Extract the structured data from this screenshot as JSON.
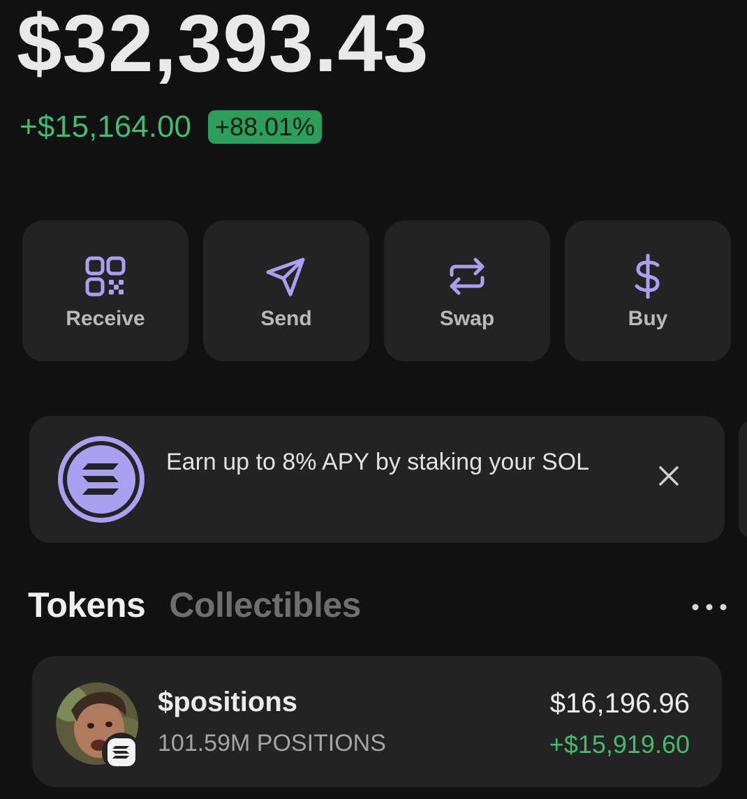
{
  "portfolio": {
    "balance": "$32,393.43",
    "change_amount": "+$15,164.00",
    "change_percent": "+88.01%"
  },
  "actions": [
    {
      "label": "Receive",
      "icon": "qr-code-icon"
    },
    {
      "label": "Send",
      "icon": "send-icon"
    },
    {
      "label": "Swap",
      "icon": "swap-icon"
    },
    {
      "label": "Buy",
      "icon": "dollar-icon"
    }
  ],
  "promo": {
    "text": "Earn up to 8% APY by staking your SOL",
    "icon": "solana-icon"
  },
  "tabs": [
    {
      "label": "Tokens",
      "active": true
    },
    {
      "label": "Collectibles",
      "active": false
    }
  ],
  "tokens": [
    {
      "name": "$positions",
      "balance": "101.59M POSITIONS",
      "value": "$16,196.96",
      "change": "+$15,919.60"
    }
  ],
  "colors": {
    "background": "#111111",
    "card": "#232323",
    "accent": "#ab9ff2",
    "positive": "#3fbd71",
    "badge": "#2c9e5c"
  }
}
